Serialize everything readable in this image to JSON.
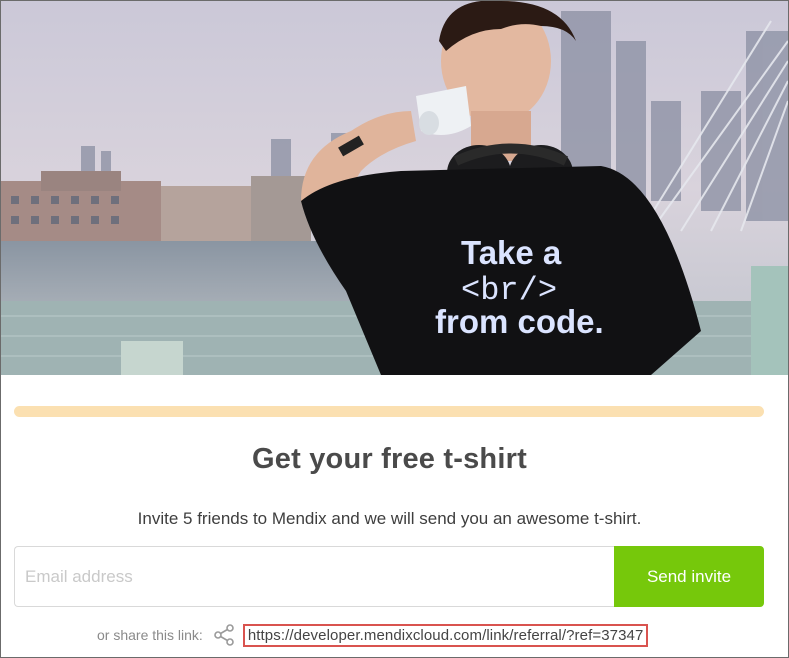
{
  "hero": {
    "image": "promo-photo-man-drinking-coffee-tshirt",
    "shirt_text_line1": "Take a",
    "shirt_text_line2": "<br/>",
    "shirt_text_line3": "from code."
  },
  "progress": {
    "fraction": 0.0,
    "track_color": "#fbe0b1"
  },
  "title": "Get your free t-shirt",
  "subtitle": "Invite 5 friends to Mendix and we will send you an awesome t-shirt.",
  "form": {
    "email_placeholder": "Email address",
    "email_value": "",
    "send_label": "Send invite",
    "button_color": "#76c80b"
  },
  "share": {
    "label": "or share this link:",
    "icon": "share-icon",
    "link": "https://developer.mendixcloud.com/link/referral/?ref=37347",
    "highlight_color": "#d9534f"
  }
}
